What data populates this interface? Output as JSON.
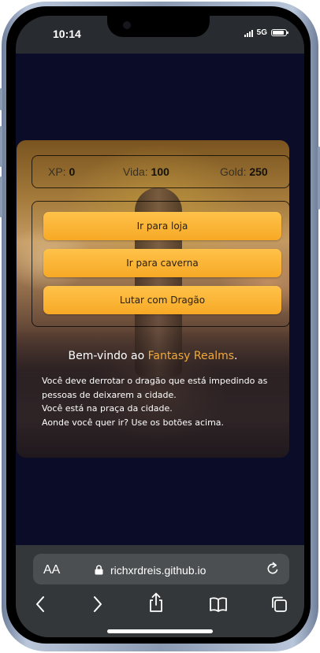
{
  "status_bar": {
    "time": "10:14",
    "network": "5G"
  },
  "game": {
    "stats": [
      {
        "label": "XP: ",
        "value": "0"
      },
      {
        "label": "Vida: ",
        "value": "100"
      },
      {
        "label": "Gold: ",
        "value": "250"
      }
    ],
    "buttons": [
      "Ir para loja",
      "Ir para caverna",
      "Lutar com Dragão"
    ],
    "welcome": {
      "prefix": "Bem-vindo ao ",
      "highlight": "Fantasy Realms",
      "suffix": "."
    },
    "story": [
      "Você deve derrotar o dragão que está impedindo as pessoas de deixarem a cidade.",
      "Você está na praça da cidade.",
      "Aonde você quer ir? Use os botões acima."
    ],
    "colors": {
      "accent": "#f7a925",
      "highlight": "#f2a93b",
      "page_bg": "#0b0c28"
    }
  },
  "browser": {
    "text_size_label": "AA",
    "url": "richxrdreis.github.io",
    "icons": [
      "text-size-icon",
      "lock-icon",
      "reload-icon",
      "back-icon",
      "forward-icon",
      "share-icon",
      "bookmarks-icon",
      "tabs-icon"
    ]
  }
}
